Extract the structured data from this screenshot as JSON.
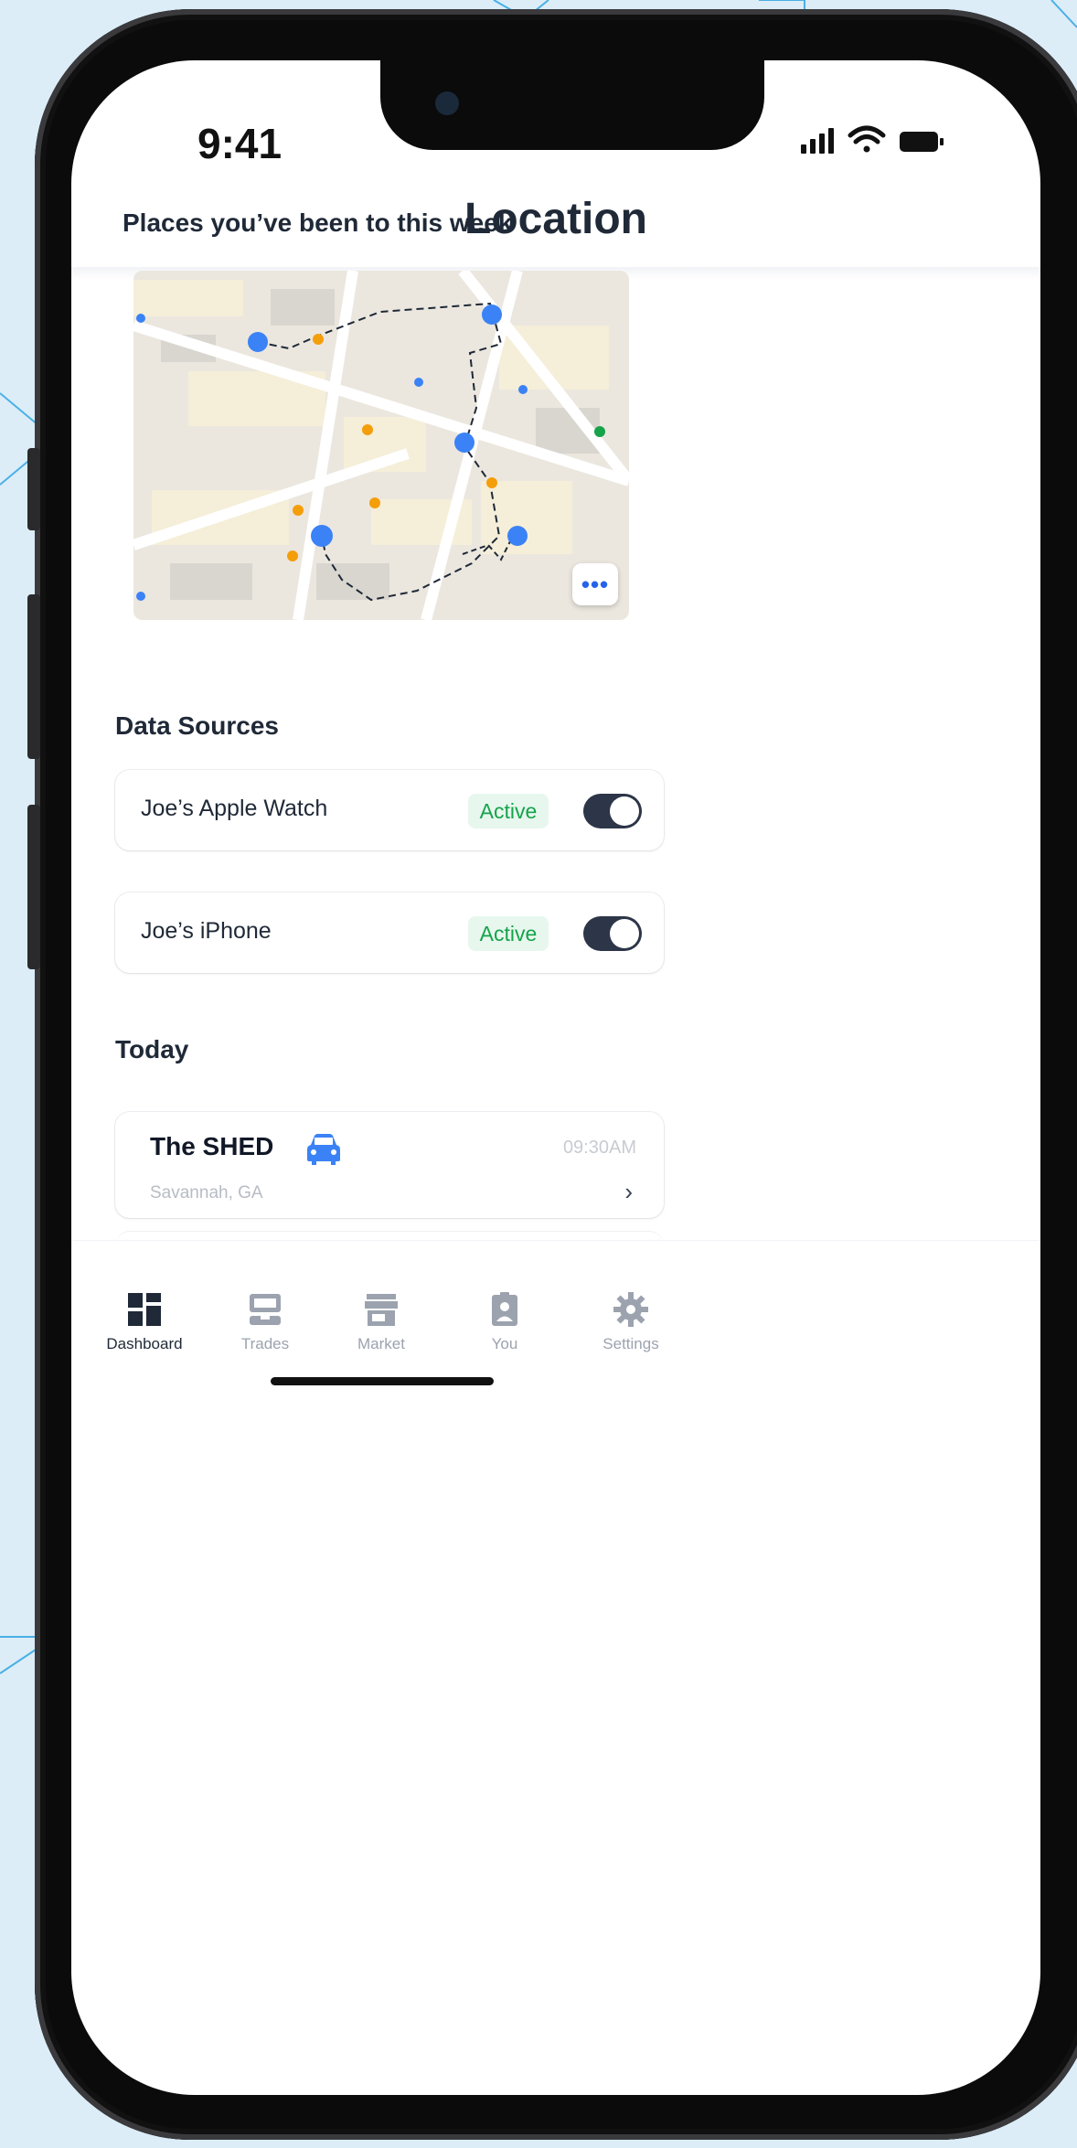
{
  "status_bar": {
    "time": "9:41"
  },
  "header": {
    "title": "Location"
  },
  "map_section": {
    "title": "Places you’ve been to this week"
  },
  "data_sources": {
    "title": "Data Sources",
    "items": [
      {
        "name": "Joe’s Apple Watch",
        "status": "Active",
        "enabled": true
      },
      {
        "name": "Joe’s iPhone",
        "status": "Active",
        "enabled": true
      }
    ]
  },
  "today": {
    "title": "Today",
    "items": [
      {
        "name": "The SHED",
        "location": "Savannah, GA",
        "time": "09:30AM",
        "icon": "car-icon"
      }
    ]
  },
  "tabbar": {
    "items": [
      {
        "label": "Dashboard",
        "icon": "dashboard-icon",
        "active": true
      },
      {
        "label": "Trades",
        "icon": "trades-icon",
        "active": false
      },
      {
        "label": "Market",
        "icon": "market-icon",
        "active": false
      },
      {
        "label": "You",
        "icon": "profile-icon",
        "active": false
      },
      {
        "label": "Settings",
        "icon": "gear-icon",
        "active": false
      }
    ]
  },
  "colors": {
    "accent": "#2563eb",
    "active_badge_bg": "#e7f7ee",
    "active_badge_text": "#16a34a",
    "toggle_on": "#2d3548"
  }
}
